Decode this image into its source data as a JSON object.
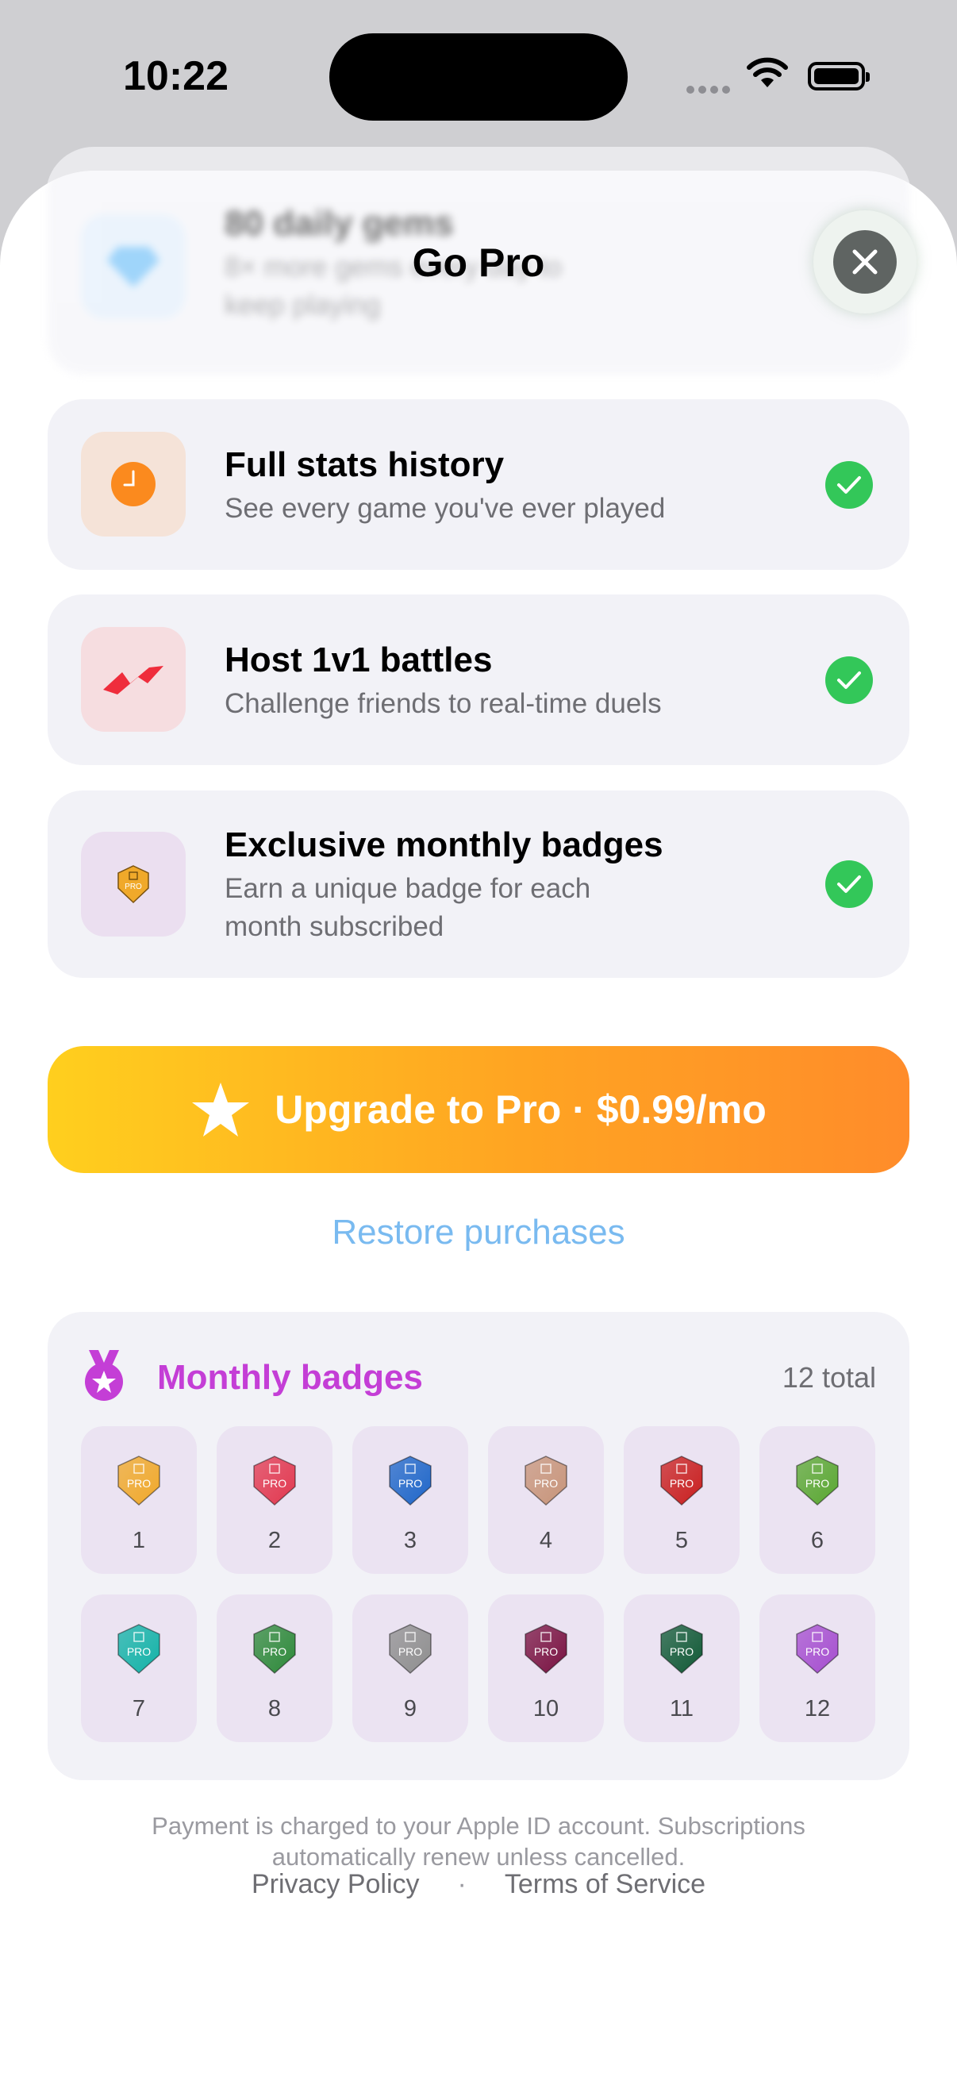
{
  "status_bar": {
    "time": "10:22"
  },
  "sheet": {
    "title": "Go Pro"
  },
  "features": [
    {
      "title": "80 daily gems",
      "subtitle_line1": "8× more gems every day to",
      "subtitle_line2": "keep playing",
      "icon": "diamond-icon"
    },
    {
      "title": "Full stats history",
      "subtitle": "See every game you've ever played",
      "icon": "clock-icon"
    },
    {
      "title": "Host 1v1 battles",
      "subtitle": "Challenge friends to real-time duels",
      "icon": "lightning-icon"
    },
    {
      "title": "Exclusive monthly badges",
      "subtitle_line1": "Earn a unique badge for each",
      "subtitle_line2": "month subscribed",
      "icon": "badge-icon"
    }
  ],
  "upgrade": {
    "label": "Upgrade to Pro · $0.99/mo",
    "icon": "star-icon"
  },
  "restore": {
    "label": "Restore purchases"
  },
  "badges": {
    "title": "Monthly badges",
    "total": "12 total",
    "shield_text": "PRO",
    "items": [
      {
        "num": "1",
        "color": "#f0a92a"
      },
      {
        "num": "2",
        "color": "#e2384f"
      },
      {
        "num": "3",
        "color": "#1f67c9"
      },
      {
        "num": "4",
        "color": "#c8957a"
      },
      {
        "num": "5",
        "color": "#c91f1f"
      },
      {
        "num": "6",
        "color": "#5aa832"
      },
      {
        "num": "7",
        "color": "#14b3a8"
      },
      {
        "num": "8",
        "color": "#2e8a3a"
      },
      {
        "num": "9",
        "color": "#8f8f8f"
      },
      {
        "num": "10",
        "color": "#7a1342"
      },
      {
        "num": "11",
        "color": "#115a36"
      },
      {
        "num": "12",
        "color": "#a64fd0"
      }
    ]
  },
  "legal": {
    "line1": "Payment is charged to your Apple ID account. Subscriptions",
    "line2": "automatically renew unless cancelled.",
    "privacy": "Privacy Policy",
    "separator": "·",
    "terms": "Terms of Service"
  },
  "colors": {
    "accent_purple": "#c43ed6",
    "check_green": "#33c759",
    "link_blue": "#79baf0"
  }
}
